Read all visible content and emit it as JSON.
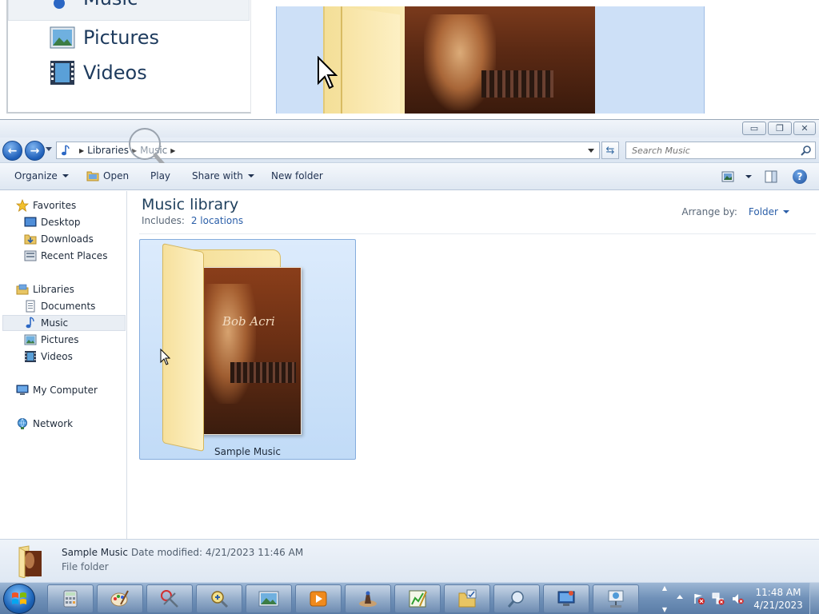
{
  "magnifier": {
    "items": [
      {
        "label": "Music",
        "icon": "music-icon"
      },
      {
        "label": "Pictures",
        "icon": "pictures-icon"
      },
      {
        "label": "Videos",
        "icon": "videos-icon"
      }
    ]
  },
  "window": {
    "buttons": {
      "minimize": "▭",
      "maximize": "❐",
      "close": "✕"
    }
  },
  "address": {
    "segments": [
      "Libraries",
      "Music"
    ],
    "search_placeholder": "Search Music"
  },
  "toolbar": {
    "organize": "Organize",
    "open": "Open",
    "play": "Play",
    "share_with": "Share with",
    "new_folder": "New folder"
  },
  "nav": {
    "favorites": "Favorites",
    "desktop": "Desktop",
    "downloads": "Downloads",
    "recent_places": "Recent Places",
    "libraries": "Libraries",
    "documents": "Documents",
    "music": "Music",
    "pictures": "Pictures",
    "videos": "Videos",
    "my_computer": "My Computer",
    "network": "Network"
  },
  "library": {
    "title": "Music library",
    "includes_label": "Includes:",
    "includes_link": "2 locations",
    "arrange_label": "Arrange by:",
    "arrange_value": "Folder"
  },
  "items": [
    {
      "name": "Sample Music",
      "album_text": "Bob Acri"
    }
  ],
  "details": {
    "name": "Sample Music",
    "modified": "Date modified: 4/21/2023 11:46 AM",
    "type": "File folder"
  },
  "taskbar": {
    "apps": [
      "calculator-icon",
      "paint-icon",
      "snipping-tool-icon",
      "magnifier-app-icon",
      "photo-viewer-icon",
      "media-player-icon",
      "ink-icon",
      "chart-editor-icon",
      "explorer-icon",
      "search-app-icon",
      "remote-desktop-icon",
      "network-app-icon"
    ],
    "time": "11:48 AM",
    "date": "4/21/2023"
  },
  "colors": {
    "accent": "#2a5ea8",
    "selection": "#c1dbf7",
    "taskbar": "#6f90b8"
  }
}
